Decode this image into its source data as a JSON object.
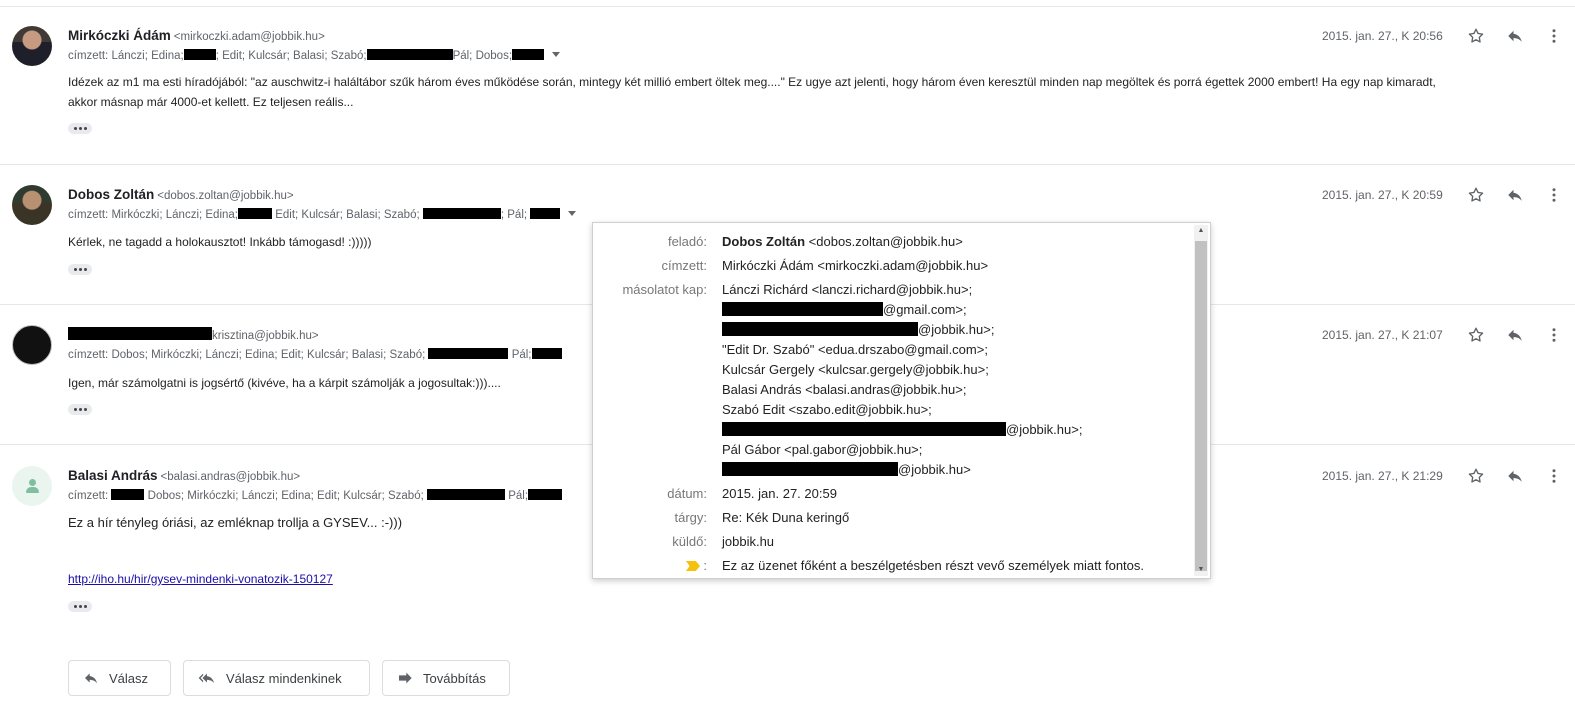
{
  "messages": [
    {
      "sender": "Mirkóczki Ádám",
      "address": "<mirkoczki.adam@jobbik.hu>",
      "recipients": {
        "a": "címzett: Lánczi; Edina;",
        "b": "; Edit; Kulcsár; Balasi; Szabó;",
        "c": "Pál; Dobos;"
      },
      "date": "2015. jan. 27., K 20:56",
      "body_line1": "Idézek az m1 ma esti híradójából: \"az auschwitz-i haláltábor szűk három éves működése során, mintegy két millió embert öltek meg....\" Ez ugye azt jelenti, hogy három éven keresztül minden nap megöltek és porrá égettek 2000 embert! Ha egy nap kimaradt,",
      "body_line2": "akkor másnap már 4000-et kellett. Ez teljesen reális..."
    },
    {
      "sender": "Dobos Zoltán",
      "address": "<dobos.zoltan@jobbik.hu>",
      "recipients": {
        "a": "címzett: Mirkóczki; Lánczi; Edina;",
        "b": "Edit; Kulcsár; Balasi; Szabó;",
        "c": "; Pál;"
      },
      "date": "2015. jan. 27., K 20:59",
      "body_line1": "Kérlek, ne tagadd a holokausztot! Inkább támogasd! :)))))"
    },
    {
      "address": "krisztina@jobbik.hu>",
      "recipients": {
        "a": "címzett: Dobos; Mirkóczki; Lánczi; Edina; Edit; Kulcsár; Balasi; Szabó;",
        "b": "Pál;"
      },
      "date": "2015. jan. 27., K 21:07",
      "body_line1": "Igen, már számolgatni is jogsértő (kivéve, ha a kárpit számolják a jogosultak:)))...."
    },
    {
      "sender": "Balasi András",
      "address": "<balasi.andras@jobbik.hu>",
      "recipients": {
        "a": "címzett:",
        "b": "Dobos; Mirkóczki; Lánczi; Edina; Edit; Kulcsár; Szabó;",
        "c": "Pál;"
      },
      "date": "2015. jan. 27., K 21:29",
      "body_line1": "Ez a hír tényleg óriási, az emléknap trollja a GYSEV... :-)))",
      "link": "http://iho.hu/hir/gysev-mindenki-vonatozik-150127"
    }
  ],
  "popup": {
    "labels": {
      "from": "feladó:",
      "to": "címzett:",
      "cc": "másolatot kap:",
      "date": "dátum:",
      "subject": "tárgy:",
      "mailed_by": "küldő:",
      "important": ":"
    },
    "from_name": "Dobos Zoltán",
    "from_addr": "<dobos.zoltan@jobbik.hu>",
    "to": "Mirkóczki Ádám <mirkoczki.adam@jobbik.hu>",
    "cc": [
      "Lánczi Richárd <lanczi.richard@jobbik.hu>;",
      "@gmail.com>;",
      "@jobbik.hu>;",
      "\"Edit Dr. Szabó\" <edua.drszabo@gmail.com>;",
      "Kulcsár Gergely <kulcsar.gergely@jobbik.hu>;",
      "Balasi András <balasi.andras@jobbik.hu>;",
      "Szabó Edit <szabo.edit@jobbik.hu>;",
      "@jobbik.hu>;",
      "Pál Gábor <pal.gabor@jobbik.hu>;",
      "@jobbik.hu>"
    ],
    "date": "2015. jan. 27. 20:59",
    "subject": "Re: Kék Duna keringő",
    "mailed_by": "jobbik.hu",
    "important_note": "Ez az üzenet főként a beszélgetésben részt vevő személyek miatt fontos."
  },
  "actions": {
    "reply": "Válasz",
    "reply_all": "Válasz mindenkinek",
    "forward": "Továbbítás"
  },
  "icons": [
    "star-icon",
    "reply-icon",
    "more-vert-icon",
    "ellipsis-icon",
    "reply-all-icon",
    "forward-icon",
    "important-marker-icon"
  ],
  "colors": {
    "link": "#1a0dab",
    "important": "#f4c20d",
    "redaction": "#000000"
  }
}
